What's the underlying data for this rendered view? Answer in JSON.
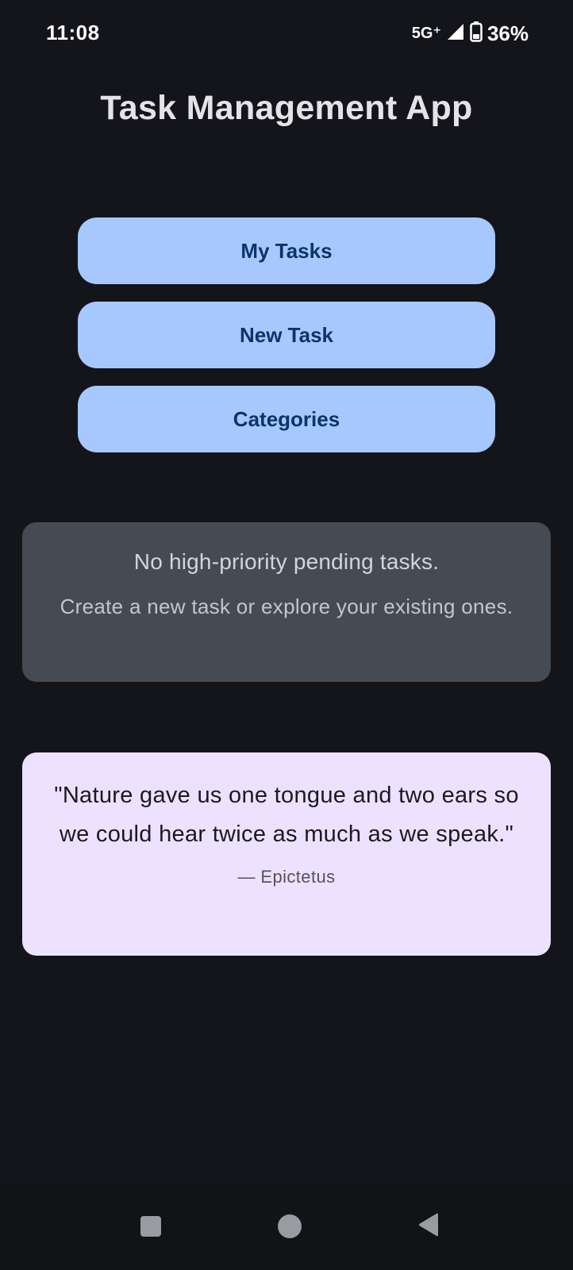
{
  "status_bar": {
    "time": "11:08",
    "network": "5G⁺",
    "battery": "36%"
  },
  "app": {
    "title": "Task Management App"
  },
  "menu": {
    "my_tasks": "My Tasks",
    "new_task": "New Task",
    "categories": "Categories"
  },
  "empty_state": {
    "title": "No high-priority pending tasks.",
    "subtitle": "Create a new task or explore your existing ones."
  },
  "quote": {
    "text": "\"Nature gave us one tongue and two ears so we could hear twice as much as we speak.\"",
    "author": "— Epictetus"
  },
  "colors": {
    "background": "#14151a",
    "button_bg": "#a6c8ff",
    "button_text": "#0d3469",
    "empty_card_bg": "#464b53",
    "quote_card_bg": "#ece2ff"
  },
  "icons": {
    "signal": "signal-icon",
    "battery": "battery-icon",
    "nav_recent": "recent-apps-icon",
    "nav_home": "home-icon",
    "nav_back": "back-icon"
  }
}
